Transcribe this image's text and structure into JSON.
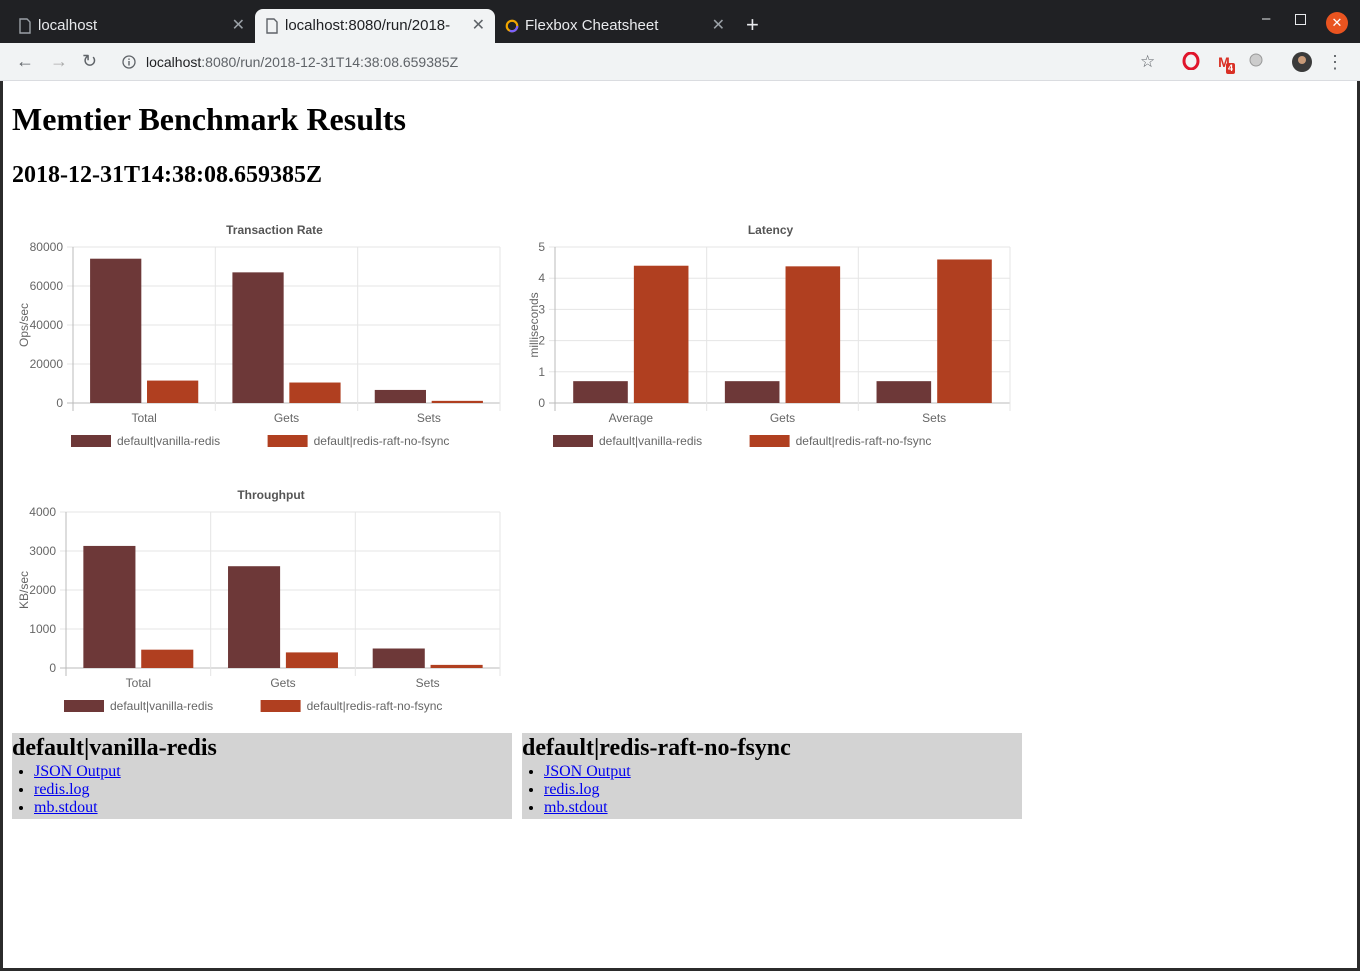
{
  "browser": {
    "tabs": [
      {
        "title": "localhost"
      },
      {
        "title": "localhost:8080/run/2018-"
      },
      {
        "title": "Flexbox Cheatsheet"
      }
    ],
    "url_host": "localhost",
    "url_rest": ":8080/run/2018-12-31T14:38:08.659385Z",
    "gmail_badge": "4"
  },
  "page": {
    "title": "Memtier Benchmark Results",
    "timestamp": "2018-12-31T14:38:08.659385Z"
  },
  "colors": {
    "series1": "#6d3838",
    "series2": "#b03f20"
  },
  "chart_data": [
    {
      "type": "bar",
      "title": "Transaction Rate",
      "ylabel": "Ops/sec",
      "categories": [
        "Total",
        "Gets",
        "Sets"
      ],
      "ylim": [
        0,
        80000
      ],
      "yticks": [
        0,
        20000,
        40000,
        60000,
        80000
      ],
      "series": [
        {
          "name": "default|vanilla-redis",
          "values": [
            74000,
            67000,
            6700
          ]
        },
        {
          "name": "default|redis-raft-no-fsync",
          "values": [
            11500,
            10500,
            1100
          ]
        }
      ],
      "legend": "bottom"
    },
    {
      "type": "bar",
      "title": "Latency",
      "ylabel": "milliseconds",
      "categories": [
        "Average",
        "Gets",
        "Sets"
      ],
      "ylim": [
        0,
        5
      ],
      "yticks": [
        0,
        1,
        2,
        3,
        4,
        5
      ],
      "series": [
        {
          "name": "default|vanilla-redis",
          "values": [
            0.7,
            0.7,
            0.7
          ]
        },
        {
          "name": "default|redis-raft-no-fsync",
          "values": [
            4.4,
            4.38,
            4.6
          ]
        }
      ],
      "legend": "bottom"
    },
    {
      "type": "bar",
      "title": "Throughput",
      "ylabel": "KB/sec",
      "categories": [
        "Total",
        "Gets",
        "Sets"
      ],
      "ylim": [
        0,
        4000
      ],
      "yticks": [
        0,
        1000,
        2000,
        3000,
        4000
      ],
      "series": [
        {
          "name": "default|vanilla-redis",
          "values": [
            3130,
            2610,
            500
          ]
        },
        {
          "name": "default|redis-raft-no-fsync",
          "values": [
            470,
            400,
            80
          ]
        }
      ],
      "legend": "bottom"
    }
  ],
  "runs": [
    {
      "name": "default|vanilla-redis",
      "links": [
        "JSON Output",
        "redis.log",
        "mb.stdout"
      ]
    },
    {
      "name": "default|redis-raft-no-fsync",
      "links": [
        "JSON Output",
        "redis.log",
        "mb.stdout"
      ]
    }
  ]
}
